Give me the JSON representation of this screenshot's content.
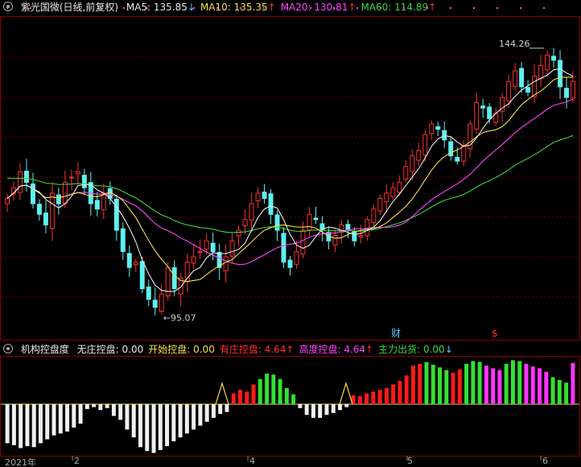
{
  "main": {
    "title": "紫光国微(日线,前复权)",
    "indicators": [
      {
        "label": "MA5:",
        "value": "135.85",
        "arrow": "↓",
        "color": "#e8e8e8"
      },
      {
        "label": "MA10:",
        "value": "135.35",
        "arrow": "↑",
        "color": "#f4e04a"
      },
      {
        "label": "MA20:",
        "value": "130.81",
        "arrow": "↑",
        "color": "#ff44ff"
      },
      {
        "label": "MA60:",
        "value": "114.89",
        "arrow": "↑",
        "color": "#3fd23f"
      }
    ],
    "high_label": "144.26",
    "low_label": "95.07",
    "event_marks": [
      {
        "text": "财",
        "color": "#5ac8ff"
      },
      {
        "text": "$",
        "color": "#ff3030"
      }
    ]
  },
  "sub": {
    "title": "机构控盘度",
    "indicators": [
      {
        "label": "无庄控盘:",
        "value": "0.00",
        "arrow": "",
        "color": "#e8e8e8"
      },
      {
        "label": "开始控盘:",
        "value": "0.00",
        "arrow": "",
        "color": "#f4e04a"
      },
      {
        "label": "有庄控盘:",
        "value": "4.64",
        "arrow": "↑",
        "color": "#ff3030"
      },
      {
        "label": "高度控盘:",
        "value": "4.64",
        "arrow": "↑",
        "color": "#ff44ff"
      },
      {
        "label": "主力出货:",
        "value": "0.00",
        "arrow": "↓",
        "color": "#3fd23f"
      }
    ]
  },
  "x_labels": [
    "2021年",
    "2",
    "4",
    "5",
    "6"
  ],
  "colors": {
    "up": "#ff3030",
    "down": "#5ff0f0",
    "ma5": "#e8e8e8",
    "ma10": "#f4e04a",
    "ma20": "#ff44ff",
    "ma60": "#3fd23f",
    "grid": "#6a0000",
    "axis": "#8b0000"
  },
  "chart_data": [
    {
      "type": "candlestick",
      "title": "紫光国微(日线,前复权)",
      "ylim": [
        90,
        150
      ],
      "high_mark": 144.26,
      "low_mark": 95.07,
      "closes": [
        116,
        118,
        121,
        119,
        115,
        113,
        111,
        117,
        115,
        119,
        120,
        121,
        118,
        115,
        114,
        117,
        116,
        110,
        106,
        103,
        104,
        99,
        97,
        95.5,
        98,
        103,
        99,
        101,
        104,
        105,
        106,
        108,
        106,
        103,
        105,
        108,
        110,
        112,
        115,
        117,
        116,
        113,
        110,
        104,
        103,
        106,
        110,
        113,
        112,
        110,
        108,
        109,
        111,
        110,
        108,
        109,
        112,
        114,
        116,
        117,
        118,
        119,
        122,
        124,
        125,
        128,
        130,
        129,
        127,
        124,
        123,
        126,
        130,
        134,
        133,
        131,
        132,
        135,
        138,
        140,
        137,
        136,
        139,
        141,
        143,
        142,
        137,
        135,
        138
      ]
    },
    {
      "type": "bar",
      "title": "机构控盘度",
      "values": [
        -4,
        -4.2,
        -4.5,
        -4.3,
        -4.4,
        -4,
        -3.6,
        -3.2,
        -3,
        -2.8,
        -2.4,
        -2,
        -0.5,
        -0.3,
        -0.6,
        -0.4,
        -1.2,
        -1.6,
        -2.6,
        -3.4,
        -4.4,
        -4.8,
        -5,
        -4.7,
        -4.3,
        -3.8,
        -3.4,
        -3,
        -2.6,
        -2.2,
        -1.8,
        -1.4,
        -1,
        -0.8,
        1.2,
        1.6,
        1.4,
        2.2,
        2.8,
        3.4,
        3.3,
        2.8,
        1.8,
        1.1,
        -0.4,
        -1.1,
        -1.4,
        -1.4,
        -1.1,
        -0.9,
        -0.6,
        -0.3,
        1,
        0.9,
        1.2,
        1.4,
        1.6,
        1.8,
        2.2,
        2.6,
        3.2,
        4.3,
        4.5,
        4.7,
        4.4,
        4.1,
        3.8,
        3.5,
        3.9,
        4.5,
        4.8,
        4.7,
        4.3,
        4,
        3.8,
        4.5,
        4.9,
        4.8,
        4.5,
        4.2,
        4,
        3.6,
        3,
        2.7,
        2.4,
        4.6
      ],
      "colors": [
        "white",
        "white",
        "white",
        "white",
        "white",
        "white",
        "white",
        "white",
        "white",
        "white",
        "white",
        "white",
        "white",
        "white",
        "white",
        "white",
        "white",
        "white",
        "white",
        "white",
        "white",
        "white",
        "white",
        "white",
        "white",
        "white",
        "white",
        "white",
        "white",
        "white",
        "white",
        "white",
        "white",
        "white",
        "red",
        "red",
        "red",
        "red",
        "green",
        "green",
        "green",
        "green",
        "green",
        "green",
        "white",
        "white",
        "white",
        "white",
        "white",
        "white",
        "white",
        "white",
        "red",
        "red",
        "red",
        "red",
        "red",
        "red",
        "red",
        "red",
        "red",
        "red",
        "red",
        "green",
        "green",
        "green",
        "green",
        "red",
        "red",
        "green",
        "green",
        "green",
        "magenta",
        "magenta",
        "magenta",
        "green",
        "green",
        "green",
        "magenta",
        "magenta",
        "magenta",
        "magenta",
        "green",
        "green",
        "green",
        "magenta"
      ]
    }
  ]
}
